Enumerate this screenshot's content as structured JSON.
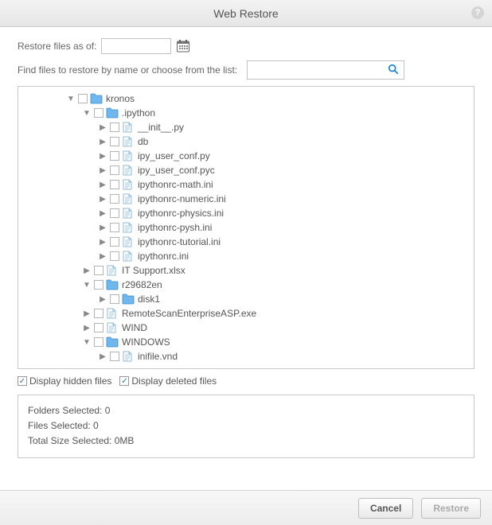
{
  "window": {
    "title": "Web Restore",
    "help_tooltip": "?"
  },
  "controls": {
    "restore_as_of_label": "Restore files as of:",
    "restore_date_value": "",
    "find_label": "Find files to restore by name or choose from the list:",
    "search_value": ""
  },
  "tree": [
    {
      "name": "kronos",
      "type": "folder",
      "expanded": true,
      "depth": 0,
      "children": [
        {
          "name": ".ipython",
          "type": "folder",
          "expanded": true,
          "depth": 1,
          "children": [
            {
              "name": "__init__.py",
              "type": "file",
              "depth": 2
            },
            {
              "name": "db",
              "type": "file",
              "depth": 2
            },
            {
              "name": "ipy_user_conf.py",
              "type": "file",
              "depth": 2
            },
            {
              "name": "ipy_user_conf.pyc",
              "type": "file",
              "depth": 2
            },
            {
              "name": "ipythonrc-math.ini",
              "type": "file",
              "depth": 2
            },
            {
              "name": "ipythonrc-numeric.ini",
              "type": "file",
              "depth": 2
            },
            {
              "name": "ipythonrc-physics.ini",
              "type": "file",
              "depth": 2
            },
            {
              "name": "ipythonrc-pysh.ini",
              "type": "file",
              "depth": 2
            },
            {
              "name": "ipythonrc-tutorial.ini",
              "type": "file",
              "depth": 2
            },
            {
              "name": "ipythonrc.ini",
              "type": "file",
              "depth": 2
            }
          ]
        },
        {
          "name": "IT Support.xlsx",
          "type": "file",
          "depth": 1
        },
        {
          "name": "r29682en",
          "type": "folder",
          "expanded": true,
          "depth": 1,
          "children": [
            {
              "name": "disk1",
              "type": "folder",
              "expanded": false,
              "depth": 2
            }
          ]
        },
        {
          "name": "RemoteScanEnterpriseASP.exe",
          "type": "file",
          "depth": 1
        },
        {
          "name": "WIND",
          "type": "file",
          "depth": 1
        },
        {
          "name": "WINDOWS",
          "type": "folder",
          "expanded": true,
          "depth": 1,
          "children": [
            {
              "name": "inifile.vnd",
              "type": "file",
              "depth": 2,
              "partial": true
            }
          ]
        }
      ]
    }
  ],
  "options": {
    "display_hidden_label": "Display hidden files",
    "display_hidden_checked": true,
    "display_deleted_label": "Display deleted files",
    "display_deleted_checked": true
  },
  "summary": {
    "folders_label": "Folders Selected:",
    "folders_value": "0",
    "files_label": "Files Selected:",
    "files_value": "0",
    "size_label": "Total Size Selected:",
    "size_value": "0MB"
  },
  "footer": {
    "cancel_label": "Cancel",
    "restore_label": "Restore"
  }
}
